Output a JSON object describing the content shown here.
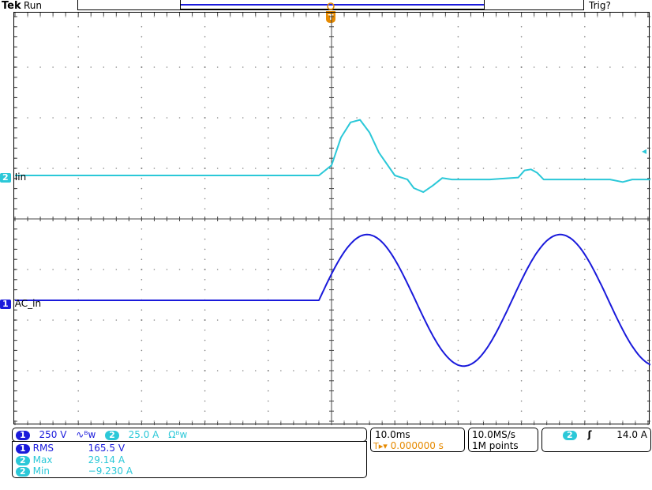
{
  "header": {
    "brand": "Tek",
    "status": "Run",
    "trigger_state": "Trig?"
  },
  "trigger_marker": {
    "label": "T"
  },
  "channels": {
    "ch2": {
      "number": "2",
      "label": "Iin",
      "color": "#2bc8d8"
    },
    "ch1": {
      "number": "1",
      "label": "AC_in",
      "color": "#1a1adb"
    }
  },
  "readouts": {
    "ch1_scale": "250 V",
    "ch1_bw": "∿ᴮw",
    "ch2_scale": "25.0 A",
    "ch2_bw": "Ωᴮw",
    "measurements": [
      {
        "ch": "1",
        "name": "RMS",
        "value": "165.5 V"
      },
      {
        "ch": "2",
        "name": "Max",
        "value": "29.14 A"
      },
      {
        "ch": "2",
        "name": "Min",
        "value": "−9.230 A"
      }
    ],
    "timebase": "10.0ms",
    "trigger_position": "0.000000 s",
    "trigger_position_prefix": "T▸▾",
    "sample_rate": "10.0MS/s",
    "record_length": "1M points",
    "trigger_channel": "2",
    "trigger_slope": "ʃ",
    "trigger_level": "14.0 A"
  },
  "chart_data": {
    "type": "line",
    "title": "",
    "xlabel": "",
    "ylabel": "",
    "divisions": {
      "x": 10,
      "y": 8
    },
    "x_units": "div",
    "y_units": "div",
    "series": [
      {
        "name": "Iin",
        "color": "#2bc8d8",
        "x": [
          -5,
          -0.2,
          0.0,
          0.15,
          0.3,
          0.45,
          0.6,
          0.75,
          1.0,
          1.2,
          1.3,
          1.45,
          1.6,
          1.75,
          1.9,
          2.5,
          2.95,
          3.05,
          3.15,
          3.25,
          3.35,
          4.0,
          4.4,
          4.6,
          4.75,
          4.9,
          5.05,
          5.6,
          6.1,
          6.2,
          6.3,
          6.4,
          6.55,
          7.1,
          7.3,
          7.4,
          7.5,
          7.6,
          8.0
        ],
        "y": [
          0,
          0,
          0.2,
          0.75,
          1.05,
          1.1,
          0.85,
          0.45,
          0,
          -0.08,
          -0.25,
          -0.33,
          -0.2,
          -0.05,
          -0.08,
          -0.08,
          -0.04,
          0.1,
          0.12,
          0.05,
          -0.08,
          -0.08,
          -0.08,
          -0.13,
          -0.08,
          -0.08,
          -0.08,
          -0.08,
          -0.08,
          0.03,
          0.04,
          -0.02,
          -0.08,
          -0.08,
          -0.08,
          -0.08,
          -0.08,
          -0.08,
          -0.08
        ]
      },
      {
        "name": "AC_in",
        "color": "#1a1adb",
        "segments": [
          {
            "kind": "flat",
            "x_start": -5,
            "x_end": -0.2,
            "y": 0
          },
          {
            "kind": "sine",
            "x_start": -0.2,
            "x_end": 8.0,
            "amplitude_div": 1.3,
            "period_div": 3.05,
            "phase_start_deg": 0
          }
        ]
      }
    ]
  }
}
